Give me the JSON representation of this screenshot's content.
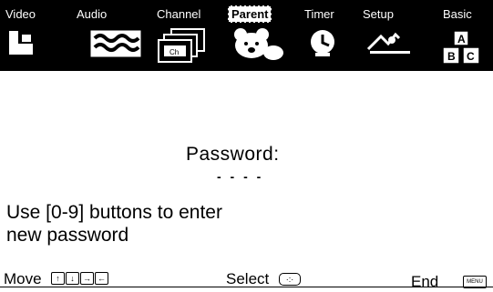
{
  "menu": {
    "tabs": [
      {
        "label": "Video",
        "icon": "video-icon",
        "active": false
      },
      {
        "label": "Audio",
        "icon": "audio-icon",
        "active": false
      },
      {
        "label": "Channel",
        "icon": "channel-icon",
        "active": false
      },
      {
        "label": "Parent",
        "icon": "parent-teddy-bear-icon",
        "active": true
      },
      {
        "label": "Timer",
        "icon": "timer-clock-icon",
        "active": false
      },
      {
        "label": "Setup",
        "icon": "setup-icon",
        "active": false
      },
      {
        "label": "Basic",
        "icon": "basic-abc-icon",
        "active": false
      }
    ]
  },
  "main": {
    "password_label": "Password:",
    "password_placeholder": "- - - -",
    "instruction": "Use [0-9] buttons to enter\nnew password"
  },
  "footer": {
    "move_label": "Move",
    "move_keys": [
      "↑",
      "↓",
      "→",
      "←"
    ],
    "select_label": "Select",
    "select_key": "·:·",
    "end_label": "End",
    "end_key": "MENU"
  }
}
